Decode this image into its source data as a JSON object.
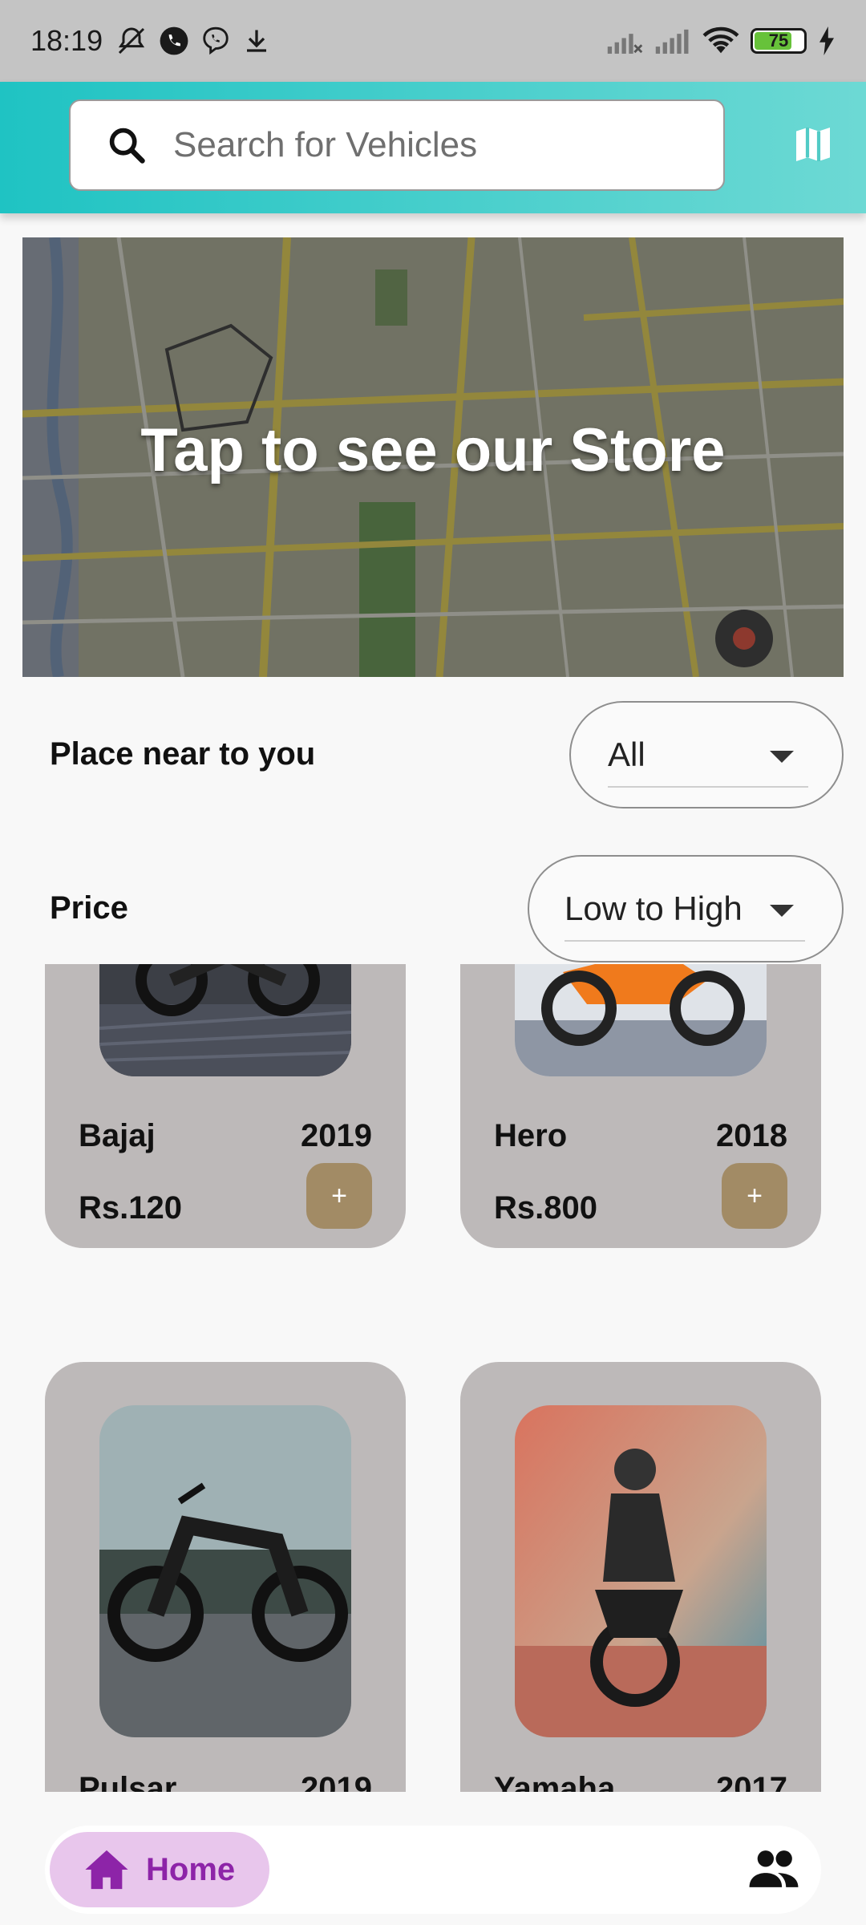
{
  "status_bar": {
    "time": "18:19",
    "battery": "75"
  },
  "search": {
    "placeholder": "Search for Vehicles"
  },
  "banner": {
    "title": "Tap to see our Store"
  },
  "filters": {
    "place": {
      "label": "Place near to you",
      "value": "All"
    },
    "price": {
      "label": "Price",
      "value": "Low to High"
    }
  },
  "vehicles": [
    {
      "name": "Bajaj",
      "year": "2019",
      "price": "Rs.120",
      "add": "+"
    },
    {
      "name": "Hero",
      "year": "2018",
      "price": "Rs.800",
      "add": "+"
    },
    {
      "name": "Pulsar",
      "year": "2019",
      "price": "",
      "add": "+"
    },
    {
      "name": "Yamaha",
      "year": "2017",
      "price": "",
      "add": "+"
    }
  ],
  "bottom_nav": {
    "home_label": "Home"
  },
  "colors": {
    "appbar_start": "#1fc3c3",
    "appbar_end": "#6dd9d4",
    "card_bg": "#bdb9b9",
    "add_button": "#a28b65",
    "nav_active_bg": "#e8c6ec",
    "nav_active_fg": "#8d24a8"
  }
}
